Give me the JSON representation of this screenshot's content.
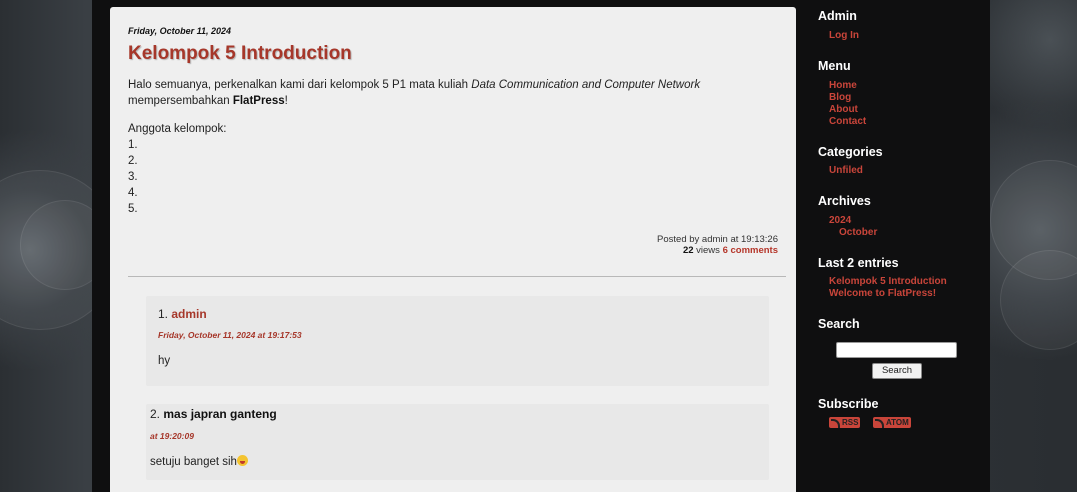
{
  "post": {
    "date": "Friday, October 11, 2024",
    "title": "Kelompok 5 Introduction",
    "intro_part1": "Halo semuanya, perkenalkan kami dari kelompok 5 P1 mata kuliah ",
    "intro_em": "Data Communication and Computer Network",
    "intro_part2": "mempersembahkan ",
    "intro_bold": "FlatPress",
    "intro_end": "!",
    "members_label": "Anggota kelompok:",
    "members": [
      "1.",
      "2.",
      "3.",
      "4.",
      "5."
    ],
    "meta_posted": "Posted by admin at 19:13:26",
    "meta_views_count": "22",
    "meta_views_label": " views ",
    "meta_comments": "6 comments"
  },
  "comments": [
    {
      "num": "1.",
      "author": "admin",
      "date": "Friday, October 11, 2024 at 19:17:53",
      "body": "hy"
    },
    {
      "num": "2.",
      "author": "mas japran ganteng",
      "date": "at 19:20:09",
      "body": "setuju banget sih"
    }
  ],
  "sidebar": {
    "admin_heading": "Admin",
    "login": "Log In",
    "menu_heading": "Menu",
    "menu": [
      "Home",
      "Blog",
      "About",
      "Contact"
    ],
    "categories_heading": "Categories",
    "categories": [
      "Unfiled"
    ],
    "archives_heading": "Archives",
    "archive_year": "2024",
    "archive_month": "October",
    "last_entries_heading": "Last 2 entries",
    "last_entries": [
      "Kelompok 5 Introduction",
      "Welcome to FlatPress!"
    ],
    "search_heading": "Search",
    "search_button": "Search",
    "subscribe_heading": "Subscribe",
    "feeds": [
      "RSS",
      "ATOM"
    ]
  },
  "colors": {
    "accent": "#a6372a",
    "sidebar_link": "#c9453a",
    "panel": "#efefef"
  }
}
